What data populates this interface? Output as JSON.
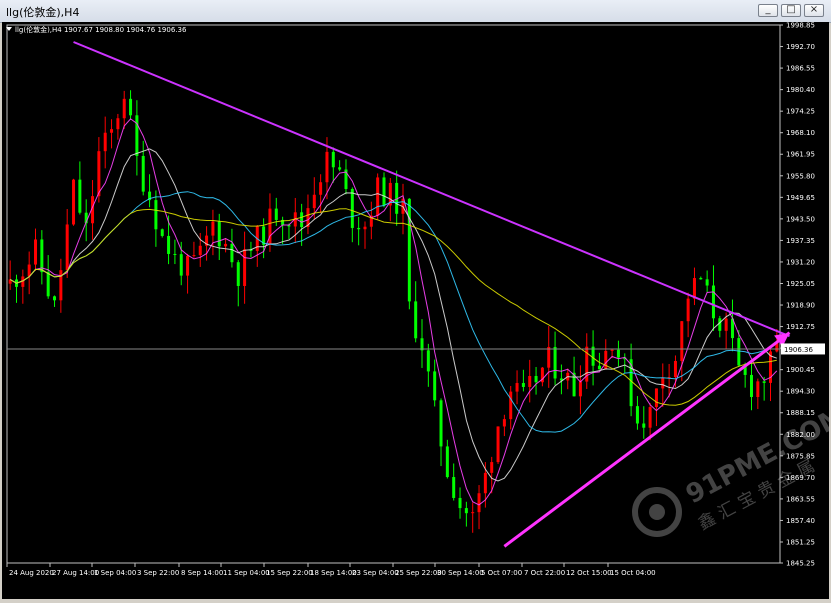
{
  "window": {
    "title": "llg(伦敦金),H4",
    "buttons": {
      "minimize": "_",
      "restore": "□",
      "close": "×"
    }
  },
  "chart_header": {
    "label": "llg(伦敦金),H4  1907.67 1908.80 1904.76 1906.36"
  },
  "colors": {
    "background": "#000000",
    "bull_candle": "#ff0000",
    "bear_candle": "#00ff00",
    "trendline": "#cc33ff",
    "arrow": "#ff33ff",
    "ma_yellow": "#e0e000",
    "ma_cyan": "#33ccff",
    "ma_magenta": "#ff44ff",
    "ma_white": "#e0e0e0",
    "price_line": "#888888"
  },
  "watermark": {
    "brand": "91PME.COM",
    "sub": "鑫 汇 宝 贵 金 属"
  },
  "chart_data": {
    "type": "candlestick",
    "current_price": 1906.36,
    "current_price_label": "1906.36",
    "ylim": [
      1845.25,
      1998.85
    ],
    "y_ticks": [
      "1998.85",
      "1992.70",
      "1986.55",
      "1980.40",
      "1974.25",
      "1968.10",
      "1961.95",
      "1955.80",
      "1949.65",
      "1943.50",
      "1937.35",
      "1931.20",
      "1925.05",
      "1918.90",
      "1912.75",
      "1906.60",
      "1900.45",
      "1894.30",
      "1888.15",
      "1882.00",
      "1875.85",
      "1869.70",
      "1863.55",
      "1857.40",
      "1851.25",
      "1845.25"
    ],
    "x_ticks": [
      "24 Aug 2020",
      "27 Aug 14:00",
      "1 Sep 04:00",
      "3 Sep 22:00",
      "8 Sep 14:00",
      "11 Sep 04:00",
      "15 Sep 22:00",
      "18 Sep 14:00",
      "23 Sep 04:00",
      "25 Sep 22:00",
      "30 Sep 14:00",
      "5 Oct 07:00",
      "7 Oct 22:00",
      "12 Oct 15:00",
      "15 Oct 04:00"
    ],
    "close_path": [
      [
        0,
        1925
      ],
      [
        4,
        1934
      ],
      [
        7,
        1918
      ],
      [
        10,
        1952
      ],
      [
        12,
        1940
      ],
      [
        14,
        1962
      ],
      [
        16,
        1968
      ],
      [
        18,
        1980
      ],
      [
        20,
        1960
      ],
      [
        22,
        1950
      ],
      [
        24,
        1938
      ],
      [
        26,
        1932
      ],
      [
        28,
        1929
      ],
      [
        30,
        1933
      ],
      [
        32,
        1942
      ],
      [
        34,
        1936
      ],
      [
        36,
        1928
      ],
      [
        38,
        1935
      ],
      [
        40,
        1940
      ],
      [
        42,
        1946
      ],
      [
        44,
        1944
      ],
      [
        46,
        1942
      ],
      [
        48,
        1953
      ],
      [
        50,
        1960
      ],
      [
        52,
        1956
      ],
      [
        54,
        1944
      ],
      [
        56,
        1942
      ],
      [
        58,
        1952
      ],
      [
        60,
        1950
      ],
      [
        62,
        1946
      ],
      [
        63,
        1918
      ],
      [
        65,
        1908
      ],
      [
        67,
        1888
      ],
      [
        69,
        1872
      ],
      [
        71,
        1862
      ],
      [
        73,
        1858
      ],
      [
        75,
        1870
      ],
      [
        77,
        1885
      ],
      [
        79,
        1895
      ],
      [
        81,
        1892
      ],
      [
        83,
        1898
      ],
      [
        85,
        1903
      ],
      [
        87,
        1900
      ],
      [
        89,
        1895
      ],
      [
        91,
        1907
      ],
      [
        93,
        1902
      ],
      [
        95,
        1910
      ],
      [
        97,
        1900
      ],
      [
        99,
        1886
      ],
      [
        101,
        1888
      ],
      [
        103,
        1900
      ],
      [
        105,
        1904
      ],
      [
        107,
        1922
      ],
      [
        109,
        1926
      ],
      [
        111,
        1917
      ],
      [
        113,
        1912
      ],
      [
        115,
        1900
      ],
      [
        117,
        1896
      ],
      [
        119,
        1898
      ],
      [
        121,
        1906
      ]
    ],
    "trendline_upper": [
      [
        10,
        1994
      ],
      [
        123,
        1910
      ]
    ],
    "trendline_lower": [
      [
        78,
        1850
      ],
      [
        123,
        1911
      ]
    ]
  }
}
